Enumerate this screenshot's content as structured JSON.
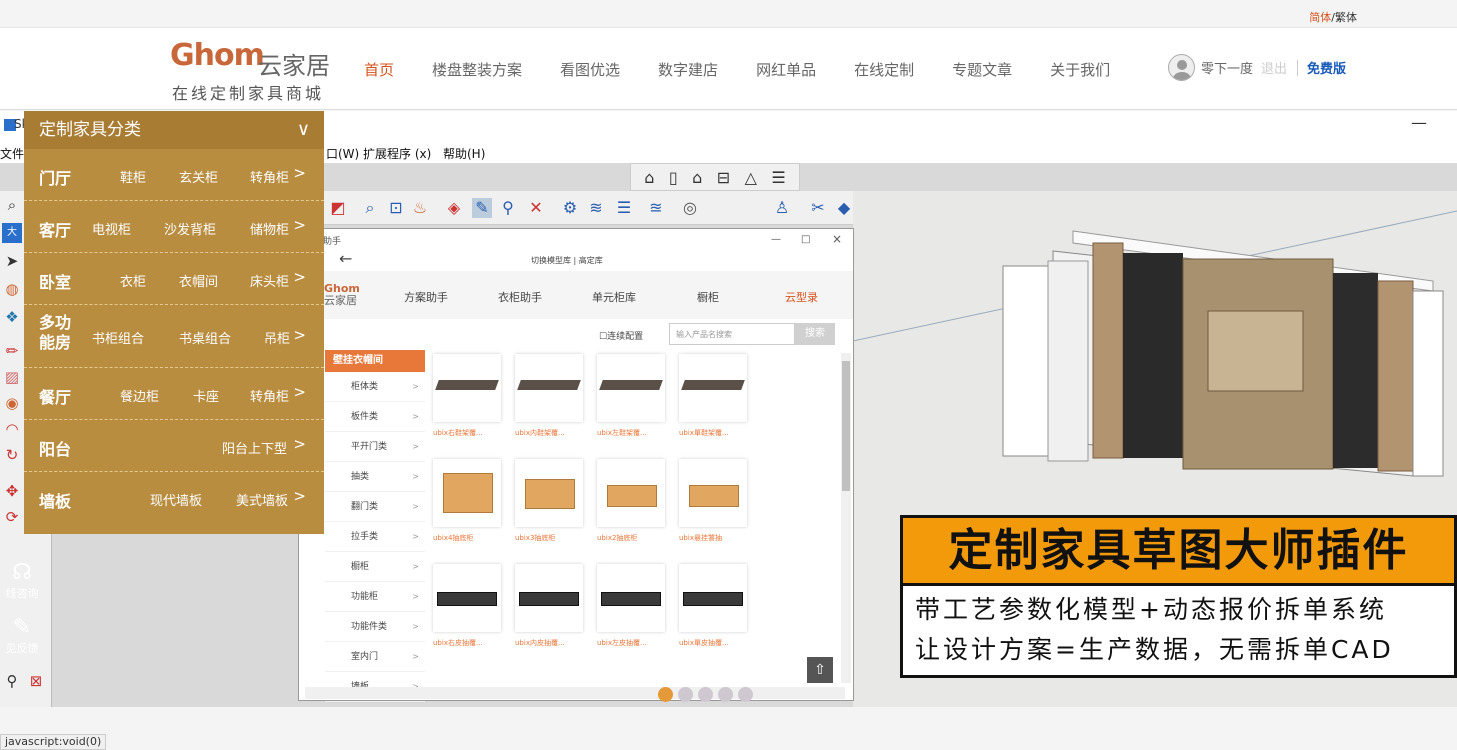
{
  "lang": {
    "simplified": "简体",
    "sep": "/",
    "traditional": "繁体"
  },
  "logo": {
    "brand": "Ghom",
    "cn": "云家居",
    "slogan": "在线定制家具商城"
  },
  "nav": [
    {
      "label": "首页",
      "active": true
    },
    {
      "label": "楼盘整装方案"
    },
    {
      "label": "看图优选"
    },
    {
      "label": "数字建店"
    },
    {
      "label": "网红单品"
    },
    {
      "label": "在线定制"
    },
    {
      "label": "专题文章"
    },
    {
      "label": "关于我们"
    }
  ],
  "user": {
    "name": "零下一度",
    "logout": "退出",
    "plan": "免费版"
  },
  "sketchup": {
    "title": "Sk",
    "minimize": "—",
    "menu": {
      "file": "文件(F)",
      "window": "口(W)",
      "ext": "扩展程序 (x)",
      "help": "帮助(H)"
    }
  },
  "plugin": {
    "title": "助手",
    "controls": [
      "—",
      "□",
      "×"
    ],
    "crumb": "切换模型库 | 高定库",
    "tabs": [
      "方案助手",
      "衣柜助手",
      "单元柜库",
      "橱柜",
      "云型录"
    ],
    "brand": "Ghom",
    "brand_cn": "云家居",
    "checkbox": "☐连续配置",
    "search_placeholder": "输入产品名搜索",
    "search_btn": "搜索",
    "side_head": "壁挂衣帽间",
    "side": [
      "柜体类",
      "板件类",
      "平开门类",
      "抽类",
      "翻门类",
      "拉手类",
      "橱柜",
      "功能柜",
      "功能件类",
      "室内门",
      "墙板"
    ],
    "products": [
      "ubix右鞋架覆...",
      "ubix内鞋架覆...",
      "ubix左鞋架覆...",
      "ubix單鞋架覆...",
      "ubix4抽底柜",
      "ubix3抽底柜",
      "ubix2抽底柜",
      "ubix悬挂饕抽",
      "ubix右皮抽覆...",
      "ubix内皮抽覆...",
      "ubix左皮抽覆...",
      "ubix單皮抽覆..."
    ]
  },
  "promo": {
    "title": "定制家具草图大师插件",
    "line1": "带工艺参数化模型+动态报价拆单系统",
    "line2": "让设计方案=生产数据，无需拆单CAD"
  },
  "category": {
    "title": "定制家具分类",
    "rows": [
      {
        "key": "门厅",
        "subs": [
          "鞋柜",
          "玄关柜",
          "转角柜"
        ]
      },
      {
        "key": "客厅",
        "subs": [
          "电视柜",
          "沙发背柜",
          "储物柜"
        ]
      },
      {
        "key": "卧室",
        "subs": [
          "衣柜",
          "衣帽间",
          "床头柜"
        ]
      },
      {
        "key": "多功能房",
        "subs": [
          "书柜组合",
          "书桌组合",
          "吊柜"
        ]
      },
      {
        "key": "餐厅",
        "subs": [
          "餐边柜",
          "卡座",
          "转角柜"
        ]
      },
      {
        "key": "阳台",
        "subs": [
          "阳台上下型"
        ]
      },
      {
        "key": "墙板",
        "subs": [
          "现代墙板",
          "美式墙板"
        ]
      }
    ]
  },
  "float": {
    "consult": "线咨询",
    "feedback": "见反馈"
  },
  "slider": {
    "count": 5,
    "active": 0
  },
  "status": "javascript:void(0)",
  "colors": {
    "accent": "#d6541e",
    "menu": "#b88d40",
    "promo": "#f39a0b",
    "plan": "#1b5bb8"
  }
}
